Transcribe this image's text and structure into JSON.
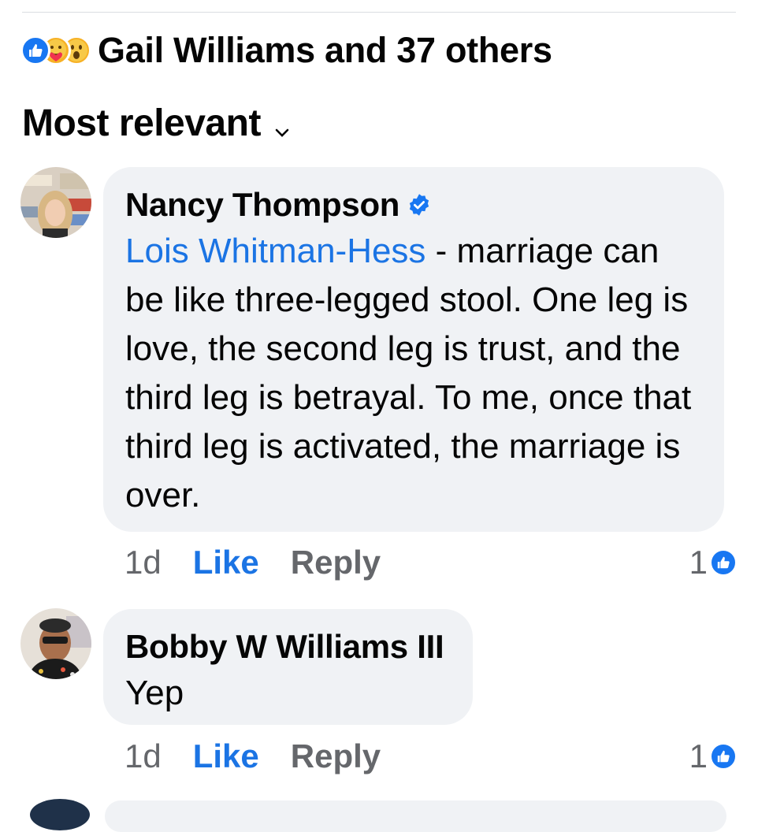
{
  "reactions": {
    "summary": "Gail Williams and 37 others",
    "types": [
      "like-icon",
      "care-icon",
      "wow-icon"
    ]
  },
  "sort": {
    "label": "Most relevant"
  },
  "comments": [
    {
      "author": "Nancy Thompson",
      "verified": true,
      "mention": "Lois Whitman-Hess",
      "text": " - marriage can be like three-legged stool. One leg is love, the second leg is trust, and the third leg is betrayal. To me, once that third leg is activated, the marriage is over.",
      "time": "1d",
      "like_label": "Like",
      "reply_label": "Reply",
      "reaction_count": "1"
    },
    {
      "author": "Bobby W Williams III",
      "verified": false,
      "text": "Yep",
      "time": "1d",
      "like_label": "Like",
      "reply_label": "Reply",
      "reaction_count": "1"
    }
  ],
  "colors": {
    "accent": "#1b74e4",
    "bubble": "#f0f2f5",
    "muted": "#65676b",
    "like_blue": "#1877f2"
  }
}
